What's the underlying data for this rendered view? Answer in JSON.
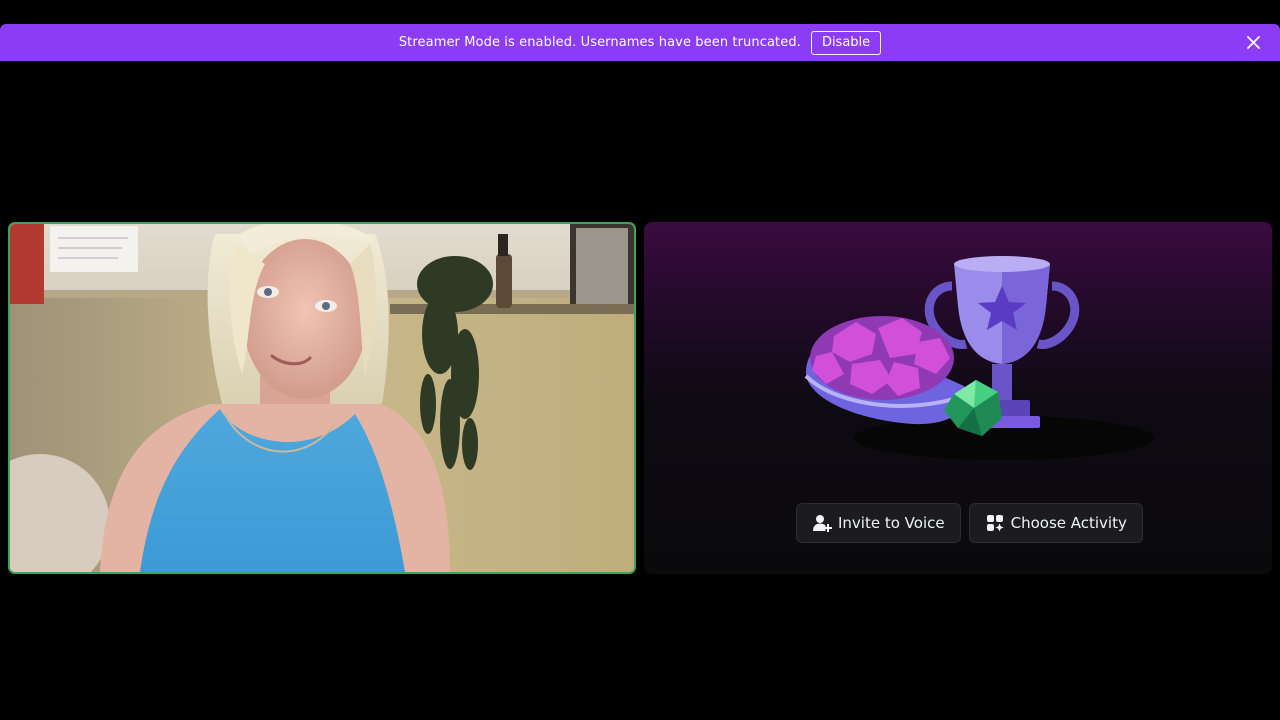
{
  "banner": {
    "message": "Streamer Mode is enabled. Usernames have been truncated.",
    "disable_label": "Disable",
    "close_icon": "close-icon",
    "background": "#8c3cf5"
  },
  "video_tile": {
    "speaking_border_color": "#3ba55d"
  },
  "activity_panel": {
    "invite_label": "Invite to Voice",
    "invite_icon": "add-user-icon",
    "activity_label": "Choose Activity",
    "activity_icon": "activity-icon"
  }
}
